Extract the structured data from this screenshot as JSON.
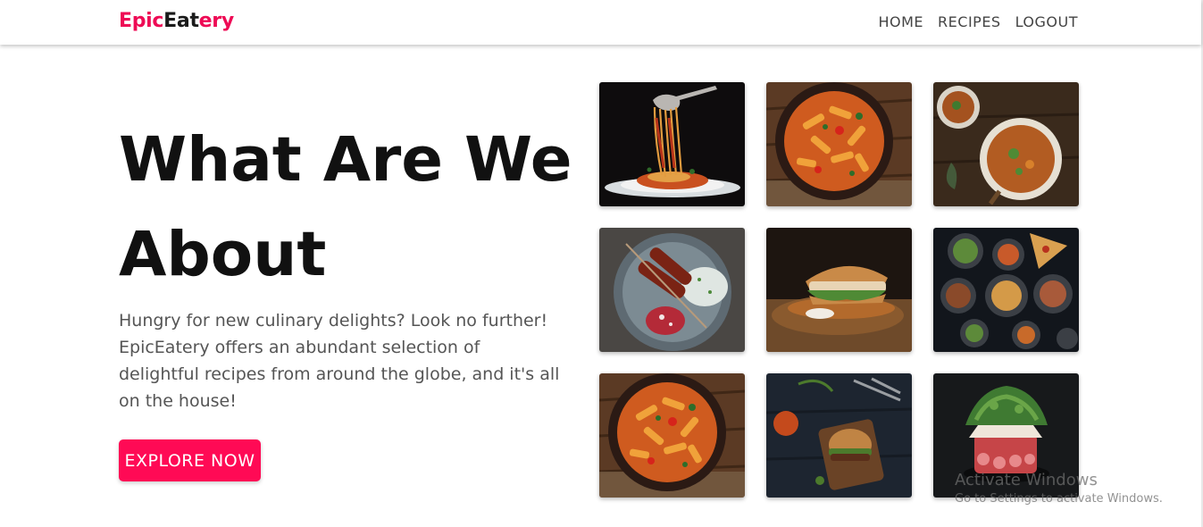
{
  "navbar": {
    "brand": {
      "part1": "Epic",
      "part2": "Eat",
      "part3": "ery"
    },
    "links": [
      "HOME",
      "RECIPES",
      "LOGOUT"
    ]
  },
  "hero": {
    "title": "What Are We About",
    "description": "Hungry for new culinary delights? Look no further! EpicEatery offers an abundant selection of delightful recipes from around the globe, and it's all on the house!",
    "cta_label": "EXPLORE NOW"
  },
  "gallery": {
    "items": [
      "spaghetti-twirl-photo",
      "penne-pasta-bowl-photo",
      "soup-bowls-photo",
      "skewer-plate-photo",
      "sandwich-board-photo",
      "tapas-spread-photo",
      "penne-pasta-bowl-photo",
      "burger-board-photo",
      "salad-tower-photo"
    ]
  },
  "watermark": {
    "title": "Activate Windows",
    "subtitle": "Go to Settings to activate Windows."
  }
}
